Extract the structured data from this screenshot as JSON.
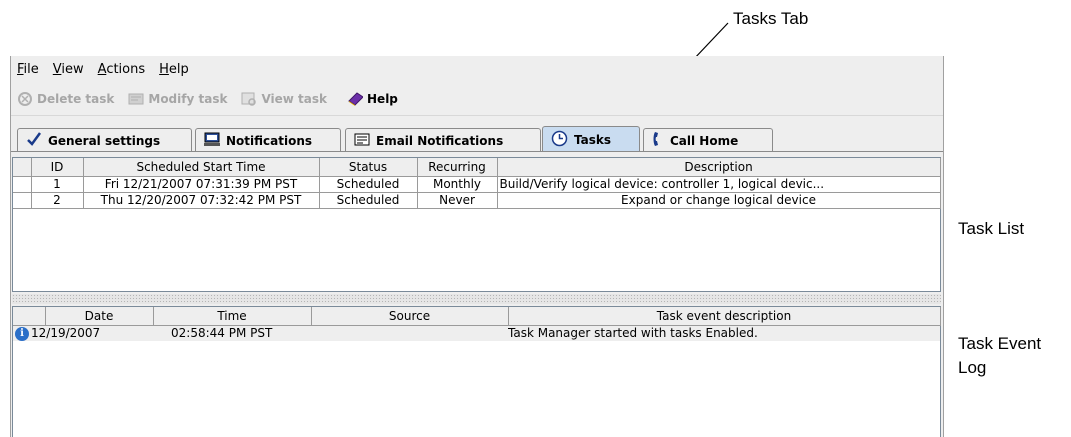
{
  "callouts": {
    "tasks_tab": "Tasks Tab",
    "task_list": "Task List",
    "task_event_log_1": "Task Event",
    "task_event_log_2": "Log"
  },
  "menu": {
    "file": {
      "accel": "F",
      "rest": "ile"
    },
    "view": {
      "accel": "V",
      "rest": "iew"
    },
    "actions": {
      "accel": "A",
      "rest": "ctions"
    },
    "help": {
      "accel": "H",
      "rest": "elp"
    }
  },
  "toolbar": {
    "delete_task": "Delete task",
    "modify_task": "Modify task",
    "view_task": "View task",
    "help": "Help"
  },
  "tabs": {
    "general": "General settings",
    "notifications": "Notifications",
    "email": "Email Notifications",
    "tasks": "Tasks",
    "callhome": "Call Home"
  },
  "task_table": {
    "headers": [
      "",
      "ID",
      "Scheduled Start Time",
      "Status",
      "Recurring",
      "Description"
    ],
    "rows": [
      [
        "",
        "1",
        "Fri 12/21/2007 07:31:39 PM PST",
        "Scheduled",
        "Monthly",
        "Build/Verify logical device: controller 1, logical devic..."
      ],
      [
        "",
        "2",
        "Thu 12/20/2007 07:32:42 PM PST",
        "Scheduled",
        "Never",
        "Expand or change logical device"
      ]
    ]
  },
  "event_table": {
    "headers": [
      "",
      "Date",
      "Time",
      "Source",
      "Task event description"
    ],
    "rows": [
      {
        "date": "12/19/2007",
        "time": "02:58:44 PM PST",
        "source": "",
        "description": "Task Manager started with tasks Enabled."
      }
    ]
  },
  "colors": {
    "selected_tab": "#c9dcf0",
    "info_icon": "#2b6fc8"
  }
}
